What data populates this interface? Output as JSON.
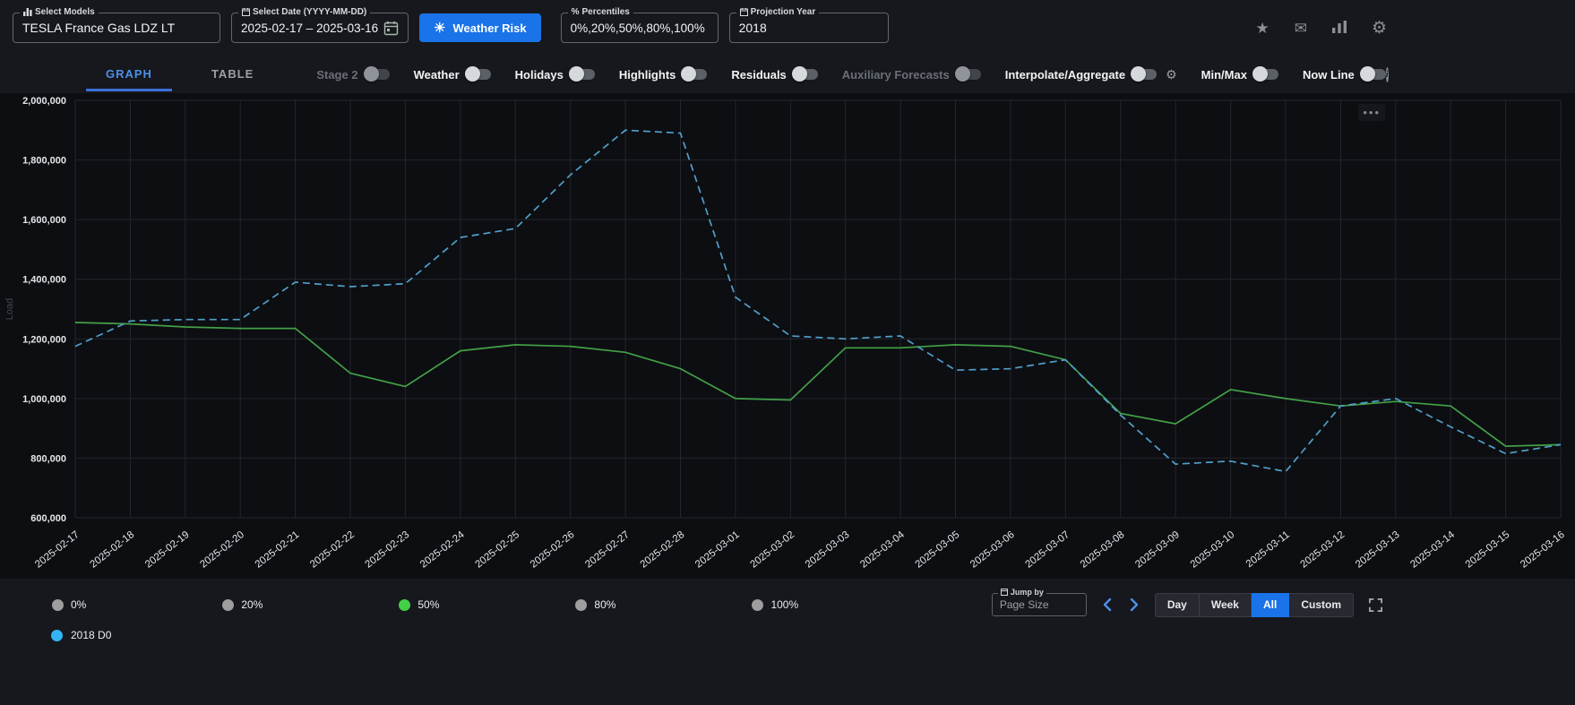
{
  "header": {
    "select_models": {
      "label": "Select Models",
      "value": "TESLA France Gas LDZ LT"
    },
    "select_date": {
      "label": "Select Date (YYYY-MM-DD)",
      "value": "2025-02-17  –  2025-03-16"
    },
    "weather_risk": {
      "label": "Weather Risk"
    },
    "percentiles": {
      "label": "Percentiles",
      "icon": "%",
      "value": "0%,20%,50%,80%,100%"
    },
    "projection_year": {
      "label": "Projection Year",
      "value": "2018"
    }
  },
  "icons": {
    "star": "★",
    "mail": "✉",
    "gear": "⚙",
    "sun": "☀",
    "info": "i",
    "menu_dots": "●●●"
  },
  "toolbar": {
    "tabs": [
      {
        "label": "GRAPH",
        "active": true
      },
      {
        "label": "TABLE",
        "active": false
      }
    ],
    "toggles": [
      {
        "label": "Stage 2",
        "on": false,
        "disabled": true
      },
      {
        "label": "Weather",
        "on": false,
        "disabled": false
      },
      {
        "label": "Holidays",
        "on": false,
        "disabled": false
      },
      {
        "label": "Highlights",
        "on": false,
        "disabled": false
      },
      {
        "label": "Residuals",
        "on": false,
        "disabled": false
      },
      {
        "label": "Auxiliary Forecasts",
        "on": false,
        "disabled": true
      },
      {
        "label": "Interpolate/Aggregate",
        "on": false,
        "disabled": false,
        "has_gear": true
      },
      {
        "label": "Min/Max",
        "on": false,
        "disabled": false
      },
      {
        "label": "Now Line",
        "on": false,
        "disabled": false
      }
    ]
  },
  "chart_data": {
    "type": "line",
    "title": "",
    "xlabel": "",
    "ylabel": "Load",
    "ylim": [
      600000,
      2000000
    ],
    "ytick_step": 200000,
    "grid": true,
    "legend_position": "bottom",
    "x": [
      "2025-02-17",
      "2025-02-18",
      "2025-02-19",
      "2025-02-20",
      "2025-02-21",
      "2025-02-22",
      "2025-02-23",
      "2025-02-24",
      "2025-02-25",
      "2025-02-26",
      "2025-02-27",
      "2025-02-28",
      "2025-03-01",
      "2025-03-02",
      "2025-03-03",
      "2025-03-04",
      "2025-03-05",
      "2025-03-06",
      "2025-03-07",
      "2025-03-08",
      "2025-03-09",
      "2025-03-10",
      "2025-03-11",
      "2025-03-12",
      "2025-03-13",
      "2025-03-14",
      "2025-03-15",
      "2025-03-16"
    ],
    "series": [
      {
        "name": "50%",
        "color": "#43a047",
        "style": "solid",
        "values": [
          1255000,
          1250000,
          1240000,
          1235000,
          1235000,
          1085000,
          1040000,
          1160000,
          1180000,
          1175000,
          1155000,
          1100000,
          1000000,
          995000,
          1170000,
          1170000,
          1180000,
          1175000,
          1130000,
          950000,
          915000,
          1030000,
          1000000,
          975000,
          990000,
          975000,
          840000,
          845000
        ]
      },
      {
        "name": "2018 D0",
        "color": "#519fc9",
        "style": "dashed",
        "values": [
          1175000,
          1260000,
          1265000,
          1265000,
          1390000,
          1375000,
          1385000,
          1540000,
          1570000,
          1750000,
          1900000,
          1890000,
          1340000,
          1210000,
          1200000,
          1210000,
          1095000,
          1100000,
          1130000,
          945000,
          780000,
          790000,
          755000,
          975000,
          1000000,
          905000,
          815000,
          845000
        ]
      }
    ]
  },
  "legend": {
    "percentiles": [
      {
        "label": "0%",
        "color": "#9e9e9e",
        "active": false
      },
      {
        "label": "20%",
        "color": "#9e9e9e",
        "active": false
      },
      {
        "label": "50%",
        "color": "#43d047",
        "active": true
      },
      {
        "label": "80%",
        "color": "#9e9e9e",
        "active": false
      },
      {
        "label": "100%",
        "color": "#9e9e9e",
        "active": false
      }
    ],
    "series": [
      {
        "label": "2018 D0",
        "color": "#33b5f5"
      }
    ]
  },
  "pagination": {
    "jump_by_label": "Jump by",
    "page_size_value": "Page Size",
    "range_buttons": [
      {
        "label": "Day",
        "active": false
      },
      {
        "label": "Week",
        "active": false
      },
      {
        "label": "All",
        "active": true
      },
      {
        "label": "Custom",
        "active": false
      }
    ]
  },
  "colors": {
    "accent_blue": "#1a73e8",
    "tab_blue": "#4d8fe8",
    "chart_background": "#0c0e12",
    "page_background": "#16181d",
    "green_series": "#43a047",
    "dashed_series": "#519fc9",
    "cyan_legend": "#33b5f5"
  }
}
